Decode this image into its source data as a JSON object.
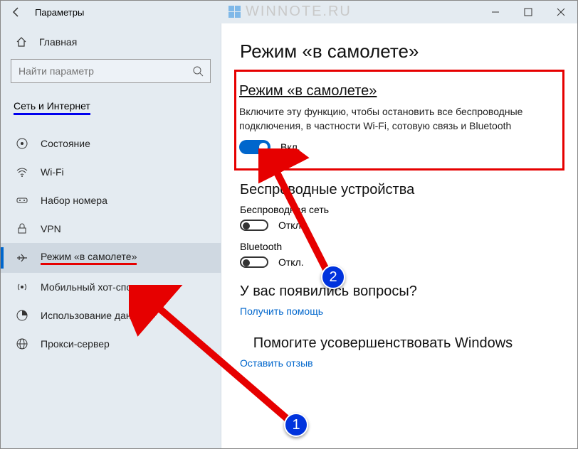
{
  "watermark": "WINNOTE.RU",
  "window": {
    "title": "Параметры"
  },
  "sidebar": {
    "home": "Главная",
    "search_placeholder": "Найти параметр",
    "section": "Сеть и Интернет",
    "items": [
      {
        "label": "Состояние"
      },
      {
        "label": "Wi-Fi"
      },
      {
        "label": "Набор номера"
      },
      {
        "label": "VPN"
      },
      {
        "label": "Режим «в самолете»"
      },
      {
        "label": "Мобильный хот-спот"
      },
      {
        "label": "Использование данных"
      },
      {
        "label": "Прокси-сервер"
      }
    ]
  },
  "main": {
    "title": "Режим «в самолете»",
    "airplane": {
      "heading": "Режим «в самолете»",
      "desc": "Включите эту функцию, чтобы остановить все беспроводные подключения, в частности Wi-Fi, сотовую связь и Bluetooth",
      "state": "Вкл."
    },
    "wireless": {
      "heading": "Беспроводные устройства",
      "wifi_label": "Беспроводная сеть",
      "wifi_state": "Откл.",
      "bt_label": "Bluetooth",
      "bt_state": "Откл."
    },
    "help": {
      "heading": "У вас появились вопросы?",
      "link": "Получить помощь"
    },
    "feedback": {
      "heading": "Помогите усовершенствовать Windows",
      "link": "Оставить отзыв"
    }
  },
  "annot": {
    "one": "1",
    "two": "2"
  }
}
